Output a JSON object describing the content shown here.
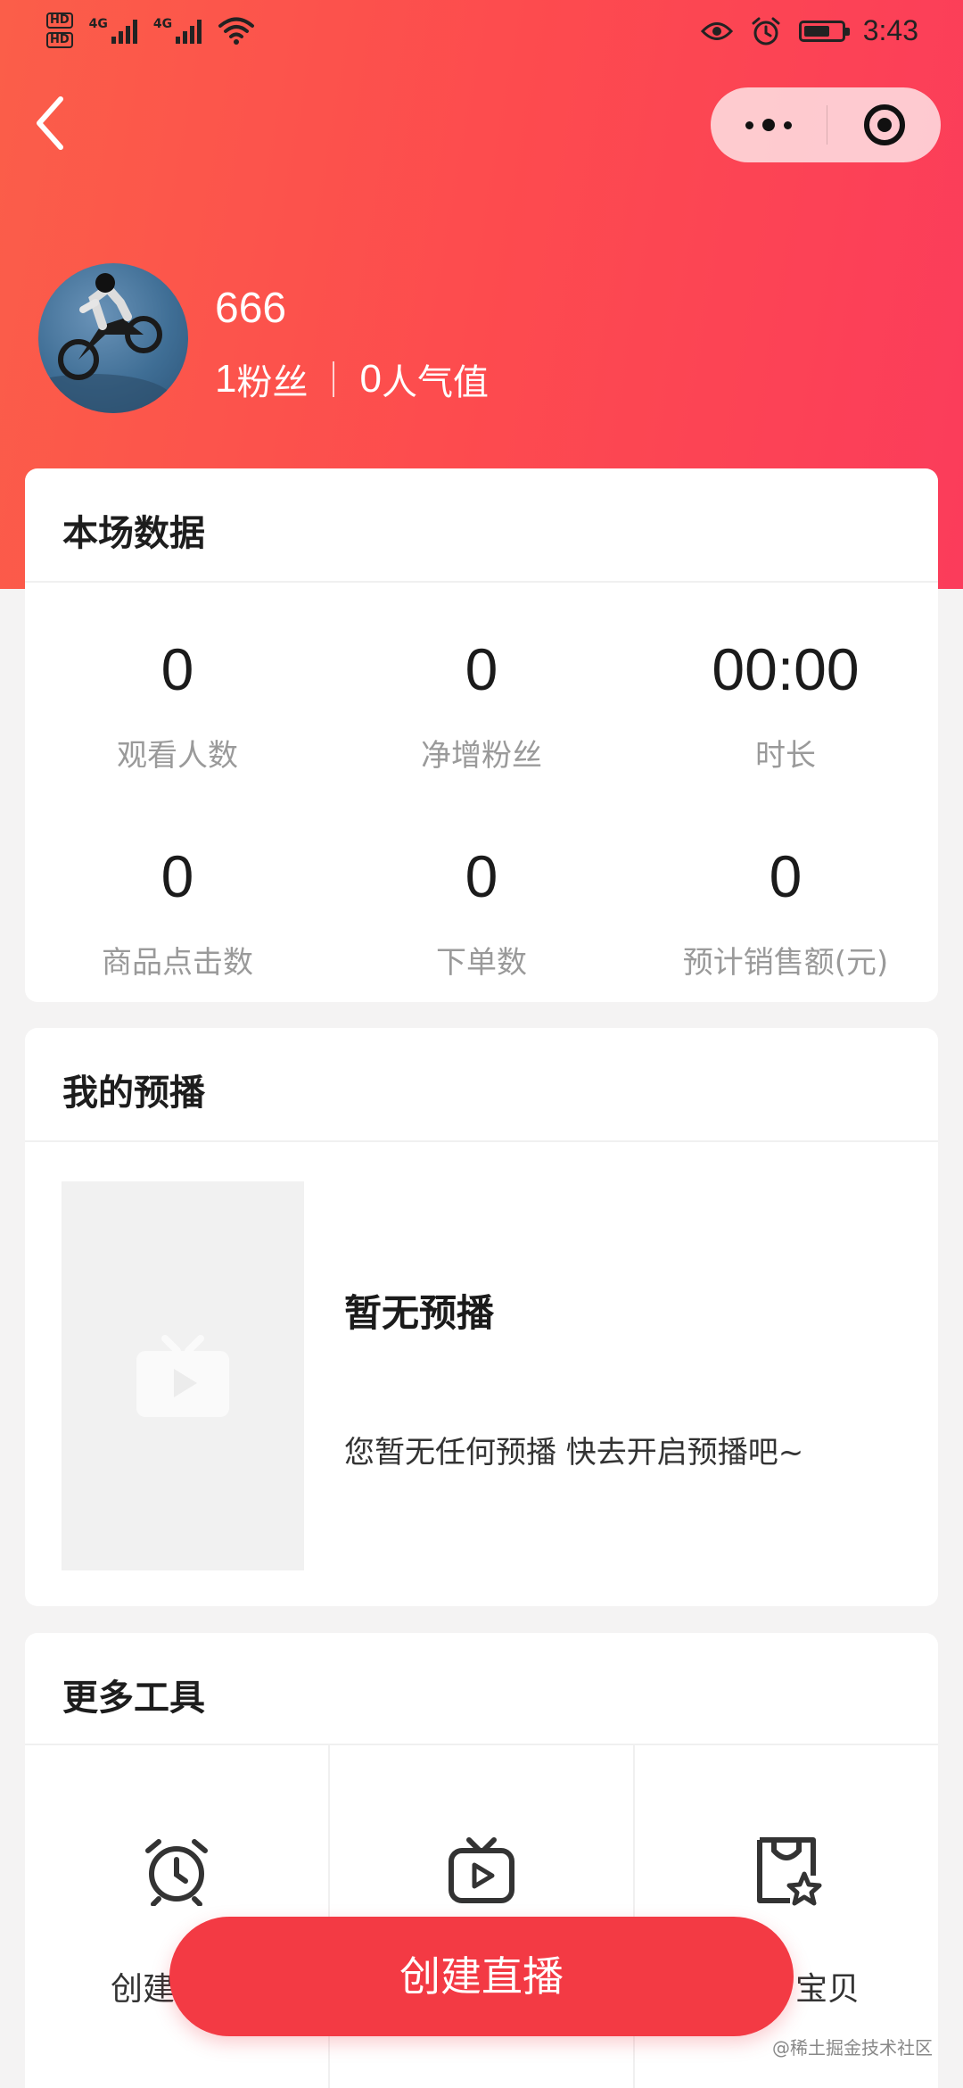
{
  "status_bar": {
    "hd_labels": [
      "HD",
      "HD"
    ],
    "signal_labels": [
      "4G",
      "4G"
    ],
    "time": "3:43",
    "battery_level": 0.7,
    "icons": [
      "eye-icon",
      "alarm-icon",
      "battery-icon",
      "wifi-icon",
      "signal-icon"
    ]
  },
  "nav": {
    "back_icon": "chevron-left-icon",
    "more_icon": "more-dots-icon",
    "close_icon": "target-icon"
  },
  "profile": {
    "name": "666",
    "fans_count": "1",
    "fans_label": "粉丝",
    "popularity_count": "0",
    "popularity_label": "人气值"
  },
  "session_data": {
    "title": "本场数据",
    "metrics": [
      {
        "value": "0",
        "label": "观看人数"
      },
      {
        "value": "0",
        "label": "净增粉丝"
      },
      {
        "value": "00:00",
        "label": "时长"
      },
      {
        "value": "0",
        "label": "商品点击数"
      },
      {
        "value": "0",
        "label": "下单数"
      },
      {
        "value": "0",
        "label": "预计销售额(元)"
      }
    ]
  },
  "preview": {
    "title": "我的预播",
    "empty_title": "暂无预播",
    "empty_desc": "您暂无任何预播 快去开启预播吧~",
    "thumb_icon": "video-icon"
  },
  "tools": {
    "title": "更多工具",
    "items": [
      {
        "label": "创建",
        "icon": "alarm-clock-icon"
      },
      {
        "label": "",
        "icon": "tv-play-icon"
      },
      {
        "label": "宝贝",
        "icon": "bag-star-icon"
      }
    ]
  },
  "primary_action": {
    "label": "创建直播"
  },
  "watermark": {
    "line1": "@稀土掘金技术社区"
  }
}
